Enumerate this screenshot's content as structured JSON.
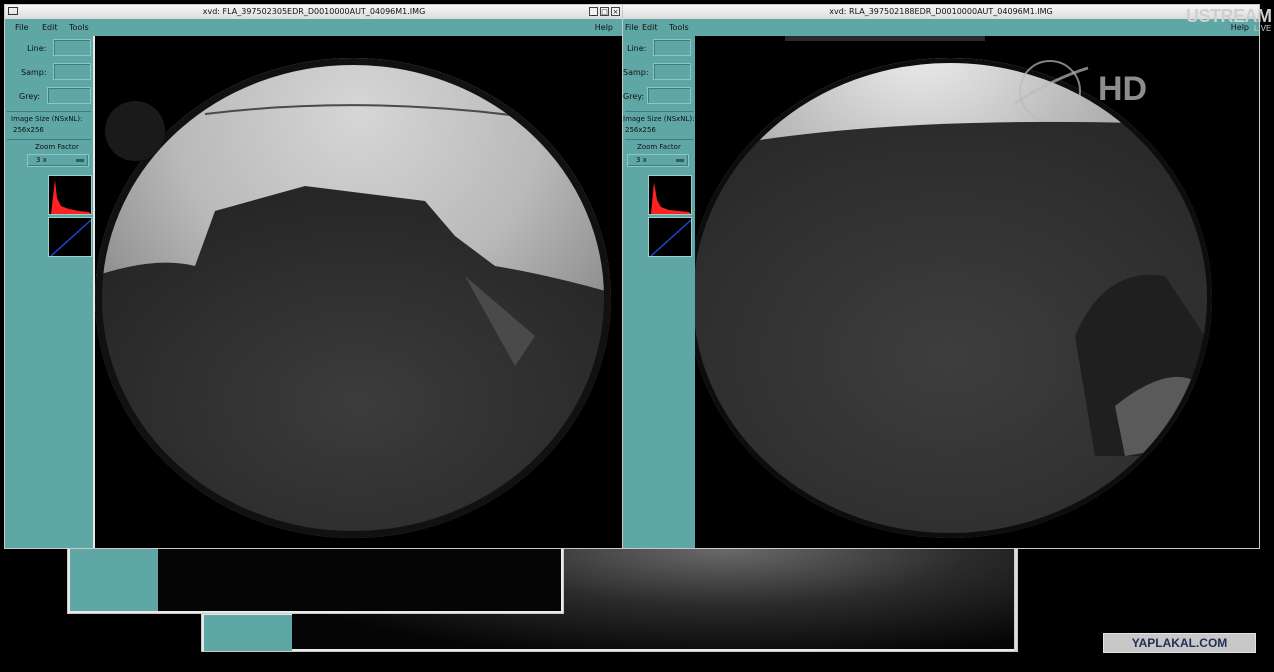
{
  "overlay": {
    "ustream": "USTREAM",
    "live": "LIVE",
    "hd": "HD",
    "watermark": "YAPLAKAL.COM"
  },
  "window_left": {
    "title": "xvd: FLA_397502305EDR_D0010000AUT_04096M1.IMG",
    "menu": {
      "file": "File",
      "edit": "Edit",
      "tools": "Tools",
      "help": "Help"
    },
    "panel": {
      "line_label": "Line:",
      "samp_label": "Samp:",
      "grey_label": "Grey:",
      "image_size_label": "Image Size (NSxNL):",
      "image_size_value": "256x256",
      "zoom_label": "Zoom Factor",
      "zoom_value": "3 x"
    }
  },
  "window_right": {
    "title": "xvd: RLA_397502188EDR_D0010000AUT_04096M1.IMG",
    "menu": {
      "file": "File",
      "edit": "Edit",
      "tools": "Tools",
      "help": "Help"
    },
    "panel": {
      "line_label": "Line:",
      "samp_label": "Samp:",
      "grey_label": "Grey:",
      "image_size_label": "Image Size (NSxNL):",
      "image_size_value": "256x256",
      "zoom_label": "Zoom Factor",
      "zoom_value": "3 x"
    }
  }
}
